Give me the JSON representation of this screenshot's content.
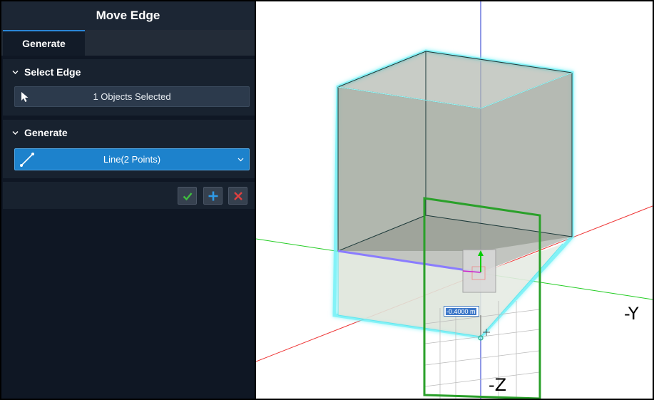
{
  "panel": {
    "title": "Move Edge",
    "tabs": [
      {
        "label": "Generate",
        "active": true
      }
    ],
    "select_edge": {
      "header": "Select Edge",
      "field_value": "1 Objects Selected",
      "icon": "cursor-arrow-icon"
    },
    "generate": {
      "header": "Generate",
      "method_value": "Line(2 Points)",
      "icon": "line-two-points-icon"
    },
    "actions": {
      "ok_icon": "checkmark-icon",
      "add_icon": "plus-icon",
      "cancel_icon": "close-icon"
    }
  },
  "viewport": {
    "axis_labels": {
      "neg_y": "-Y",
      "neg_z": "-Z"
    },
    "offset_value": "-0.4000 m"
  },
  "colors": {
    "panel_bg": "#0f1724",
    "accent_blue": "#1d82cc",
    "ok_green": "#3fbf3f",
    "add_blue": "#2f9be8",
    "cancel_red": "#e04040",
    "highlight_cyan": "#3fe6f0",
    "plane_green": "#2aa02a"
  }
}
